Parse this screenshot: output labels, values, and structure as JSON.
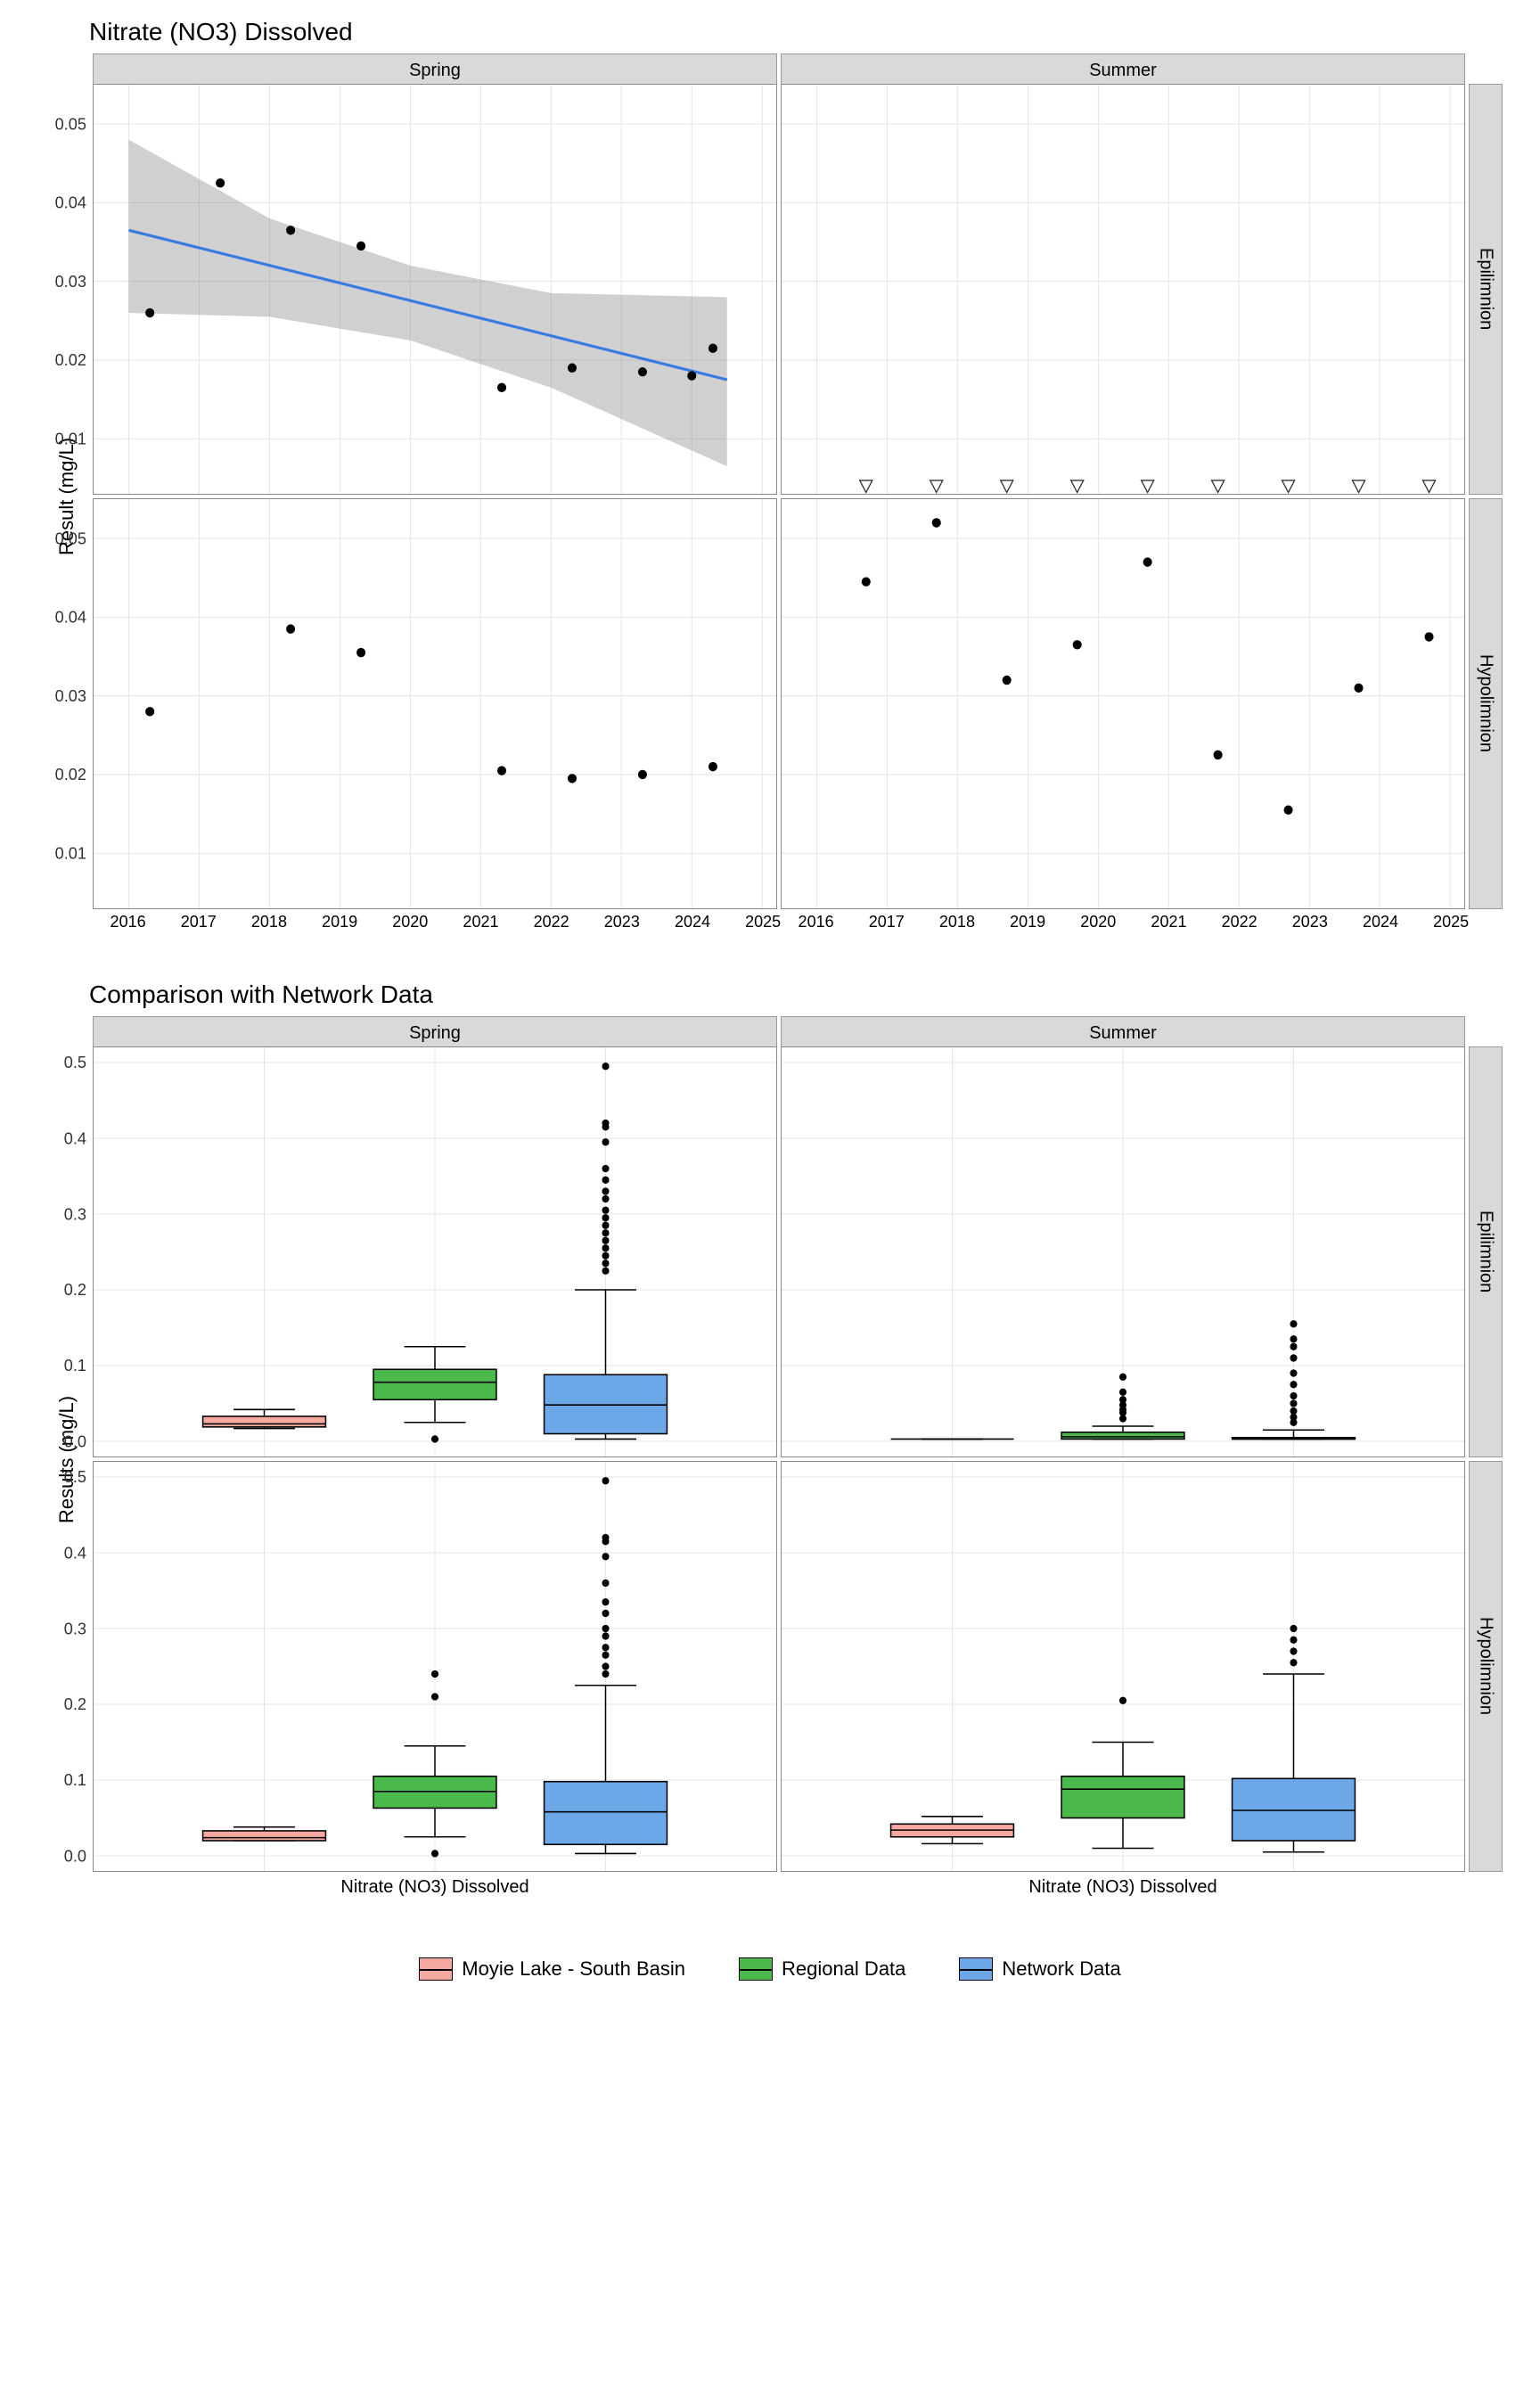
{
  "scatter": {
    "title": "Nitrate (NO3) Dissolved",
    "ylab": "Result (mg/L)",
    "cols": [
      "Spring",
      "Summer"
    ],
    "rows": [
      "Epilimnion",
      "Hypolimnion"
    ],
    "xlim": [
      2015.5,
      2025.2
    ],
    "xticks": [
      2016,
      2017,
      2018,
      2019,
      2020,
      2021,
      2022,
      2023,
      2024,
      2025
    ],
    "ylim": [
      0.003,
      0.055
    ],
    "yticks": [
      0.01,
      0.02,
      0.03,
      0.04,
      0.05
    ],
    "panels": {
      "Spring_Epilimnion": {
        "points": [
          {
            "x": 2016.3,
            "y": 0.026
          },
          {
            "x": 2017.3,
            "y": 0.0425
          },
          {
            "x": 2018.3,
            "y": 0.0365
          },
          {
            "x": 2019.3,
            "y": 0.0345
          },
          {
            "x": 2021.3,
            "y": 0.0165
          },
          {
            "x": 2022.3,
            "y": 0.019
          },
          {
            "x": 2023.3,
            "y": 0.0185
          },
          {
            "x": 2024.0,
            "y": 0.018
          },
          {
            "x": 2024.3,
            "y": 0.0215
          }
        ],
        "trend": {
          "x1": 2016,
          "y1": 0.0365,
          "x2": 2024.5,
          "y2": 0.0175
        },
        "ribbon": [
          {
            "x": 2016,
            "lo": 0.026,
            "hi": 0.048
          },
          {
            "x": 2018,
            "lo": 0.0255,
            "hi": 0.038
          },
          {
            "x": 2020,
            "lo": 0.0225,
            "hi": 0.032
          },
          {
            "x": 2022,
            "lo": 0.0165,
            "hi": 0.0285
          },
          {
            "x": 2024.5,
            "lo": 0.0065,
            "hi": 0.028
          }
        ]
      },
      "Summer_Epilimnion": {
        "triangles": [
          2016.7,
          2017.7,
          2018.7,
          2019.7,
          2020.7,
          2021.7,
          2022.7,
          2023.7,
          2024.7
        ],
        "triY": 0.004
      },
      "Spring_Hypolimnion": {
        "points": [
          {
            "x": 2016.3,
            "y": 0.028
          },
          {
            "x": 2018.3,
            "y": 0.0385
          },
          {
            "x": 2019.3,
            "y": 0.0355
          },
          {
            "x": 2021.3,
            "y": 0.0205
          },
          {
            "x": 2022.3,
            "y": 0.0195
          },
          {
            "x": 2023.3,
            "y": 0.02
          },
          {
            "x": 2024.3,
            "y": 0.021
          }
        ]
      },
      "Summer_Hypolimnion": {
        "points": [
          {
            "x": 2016.7,
            "y": 0.0445
          },
          {
            "x": 2017.7,
            "y": 0.052
          },
          {
            "x": 2018.7,
            "y": 0.032
          },
          {
            "x": 2019.7,
            "y": 0.0365
          },
          {
            "x": 2020.7,
            "y": 0.047
          },
          {
            "x": 2021.7,
            "y": 0.0225
          },
          {
            "x": 2022.7,
            "y": 0.0155
          },
          {
            "x": 2023.7,
            "y": 0.031
          },
          {
            "x": 2024.7,
            "y": 0.0375
          }
        ]
      }
    }
  },
  "box": {
    "title": "Comparison with Network Data",
    "ylab": "Results (mg/L)",
    "cols": [
      "Spring",
      "Summer"
    ],
    "rows": [
      "Epilimnion",
      "Hypolimnion"
    ],
    "xlab": "Nitrate (NO3) Dissolved",
    "ylim": [
      -0.02,
      0.52
    ],
    "yticks": [
      0.0,
      0.1,
      0.2,
      0.3,
      0.4,
      0.5
    ],
    "groups": [
      "Moyie Lake - South Basin",
      "Regional Data",
      "Network Data"
    ],
    "colors": {
      "Moyie Lake - South Basin": "#f4a8a0",
      "Regional Data": "#4bb94b",
      "Network Data": "#6ca7e8"
    },
    "panels": {
      "Spring_Epilimnion": {
        "boxes": [
          {
            "g": 0,
            "min": 0.017,
            "q1": 0.019,
            "med": 0.023,
            "q3": 0.033,
            "max": 0.042,
            "out": []
          },
          {
            "g": 1,
            "min": 0.025,
            "q1": 0.055,
            "med": 0.078,
            "q3": 0.095,
            "max": 0.125,
            "out": [
              0.003
            ]
          },
          {
            "g": 2,
            "min": 0.003,
            "q1": 0.01,
            "med": 0.048,
            "q3": 0.088,
            "max": 0.2,
            "out": [
              0.225,
              0.235,
              0.245,
              0.255,
              0.265,
              0.275,
              0.285,
              0.295,
              0.305,
              0.32,
              0.33,
              0.345,
              0.36,
              0.395,
              0.415,
              0.42,
              0.495
            ]
          }
        ]
      },
      "Summer_Epilimnion": {
        "boxes": [
          {
            "g": 0,
            "min": 0.003,
            "q1": 0.003,
            "med": 0.003,
            "q3": 0.003,
            "max": 0.003,
            "out": []
          },
          {
            "g": 1,
            "min": 0.003,
            "q1": 0.003,
            "med": 0.006,
            "q3": 0.012,
            "max": 0.02,
            "out": [
              0.03,
              0.038,
              0.042,
              0.048,
              0.055,
              0.065,
              0.085
            ]
          },
          {
            "g": 2,
            "min": 0.003,
            "q1": 0.003,
            "med": 0.003,
            "q3": 0.005,
            "max": 0.015,
            "out": [
              0.025,
              0.032,
              0.04,
              0.05,
              0.06,
              0.075,
              0.09,
              0.11,
              0.125,
              0.135,
              0.155
            ]
          }
        ]
      },
      "Spring_Hypolimnion": {
        "boxes": [
          {
            "g": 0,
            "min": 0.02,
            "q1": 0.02,
            "med": 0.024,
            "q3": 0.033,
            "max": 0.038,
            "out": []
          },
          {
            "g": 1,
            "min": 0.025,
            "q1": 0.063,
            "med": 0.085,
            "q3": 0.105,
            "max": 0.145,
            "out": [
              0.003,
              0.21,
              0.24
            ]
          },
          {
            "g": 2,
            "min": 0.003,
            "q1": 0.015,
            "med": 0.058,
            "q3": 0.098,
            "max": 0.225,
            "out": [
              0.24,
              0.25,
              0.265,
              0.275,
              0.29,
              0.3,
              0.32,
              0.335,
              0.36,
              0.395,
              0.415,
              0.42,
              0.495
            ]
          }
        ]
      },
      "Summer_Hypolimnion": {
        "boxes": [
          {
            "g": 0,
            "min": 0.016,
            "q1": 0.025,
            "med": 0.034,
            "q3": 0.042,
            "max": 0.052,
            "out": []
          },
          {
            "g": 1,
            "min": 0.01,
            "q1": 0.05,
            "med": 0.088,
            "q3": 0.105,
            "max": 0.15,
            "out": [
              0.205
            ]
          },
          {
            "g": 2,
            "min": 0.005,
            "q1": 0.02,
            "med": 0.06,
            "q3": 0.102,
            "max": 0.24,
            "out": [
              0.255,
              0.27,
              0.285,
              0.3
            ]
          }
        ]
      }
    }
  },
  "legend": [
    {
      "label": "Moyie Lake - South Basin",
      "color": "#f4a8a0"
    },
    {
      "label": "Regional Data",
      "color": "#4bb94b"
    },
    {
      "label": "Network Data",
      "color": "#6ca7e8"
    }
  ]
}
